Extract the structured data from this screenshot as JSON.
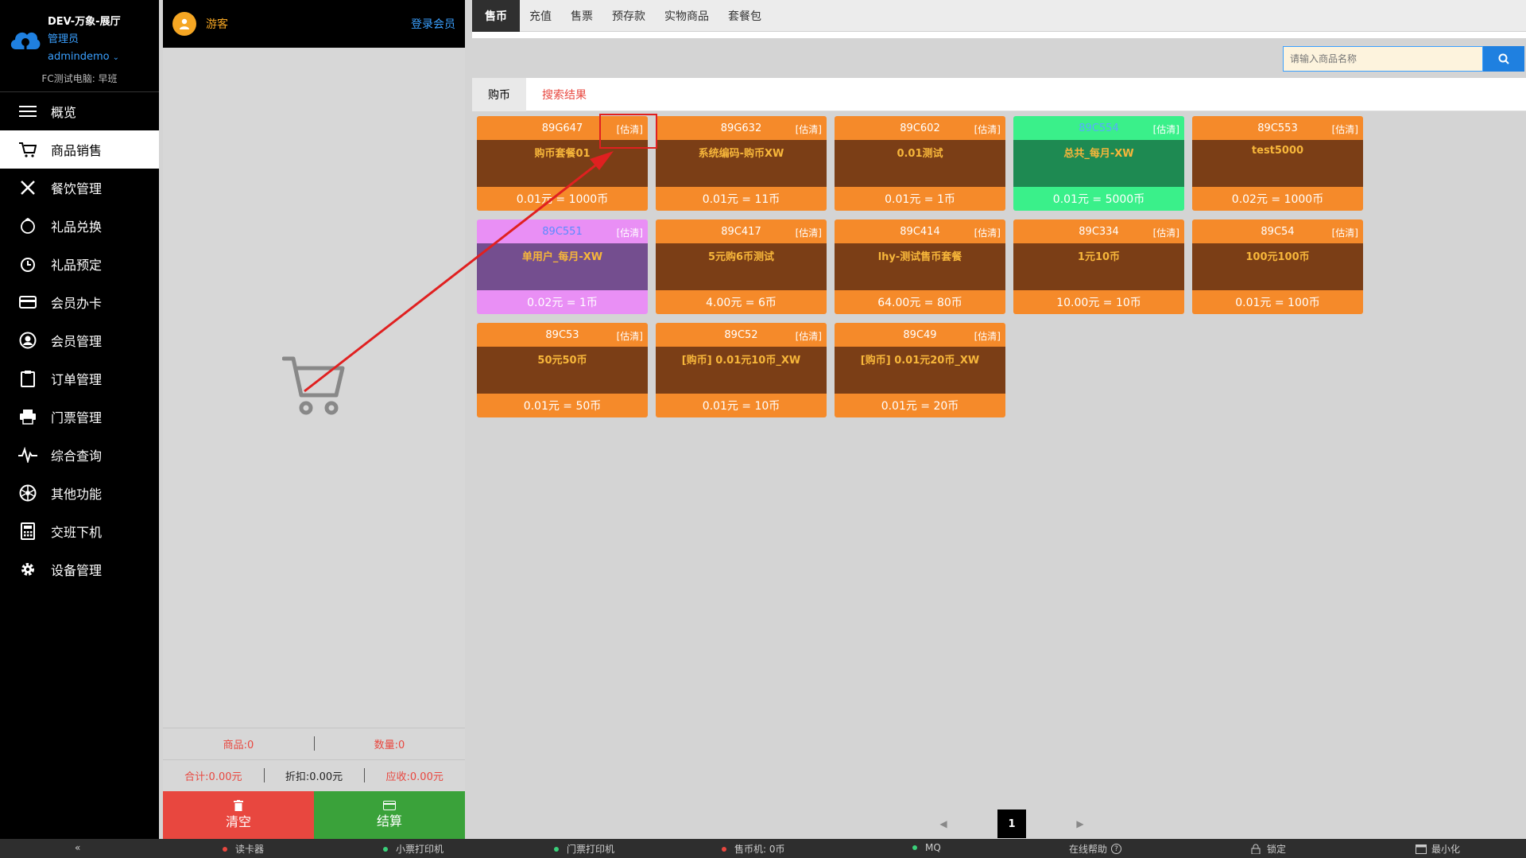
{
  "app": {
    "store_name": "DEV-万象-展厅",
    "role": "管理员",
    "username": "admindemo",
    "pc_info": "FC测试电脑: 早班"
  },
  "sidebar": {
    "items": [
      {
        "label": "概览",
        "icon": "menu-icon"
      },
      {
        "label": "商品销售",
        "icon": "cart-icon",
        "active": true
      },
      {
        "label": "餐饮管理",
        "icon": "utensils-icon"
      },
      {
        "label": "礼品兑换",
        "icon": "gift-icon"
      },
      {
        "label": "礼品预定",
        "icon": "alarm-icon"
      },
      {
        "label": "会员办卡",
        "icon": "card-icon"
      },
      {
        "label": "会员管理",
        "icon": "user-icon"
      },
      {
        "label": "订单管理",
        "icon": "clipboard-icon"
      },
      {
        "label": "门票管理",
        "icon": "printer-icon"
      },
      {
        "label": "综合查询",
        "icon": "pulse-icon"
      },
      {
        "label": "其他功能",
        "icon": "aperture-icon"
      },
      {
        "label": "交班下机",
        "icon": "calculator-icon"
      },
      {
        "label": "设备管理",
        "icon": "gear-icon"
      }
    ]
  },
  "cart": {
    "guest_label": "游客",
    "login_label": "登录会员",
    "items_label": "商品:0",
    "qty_label": "数量:0",
    "total_label": "合计:0.00元",
    "discount_label": "折扣:0.00元",
    "receivable_label": "应收:0.00元",
    "clear_label": "清空",
    "checkout_label": "结算"
  },
  "main": {
    "tabs": [
      "售币",
      "充值",
      "售票",
      "预存款",
      "实物商品",
      "套餐包"
    ],
    "search_placeholder": "请输入商品名称",
    "subtabs": [
      "购币",
      "搜索结果"
    ],
    "products": [
      {
        "code": "89G647",
        "tag": "[估清]",
        "name": "购币套餐01",
        "price": "0.01元 = 1000币",
        "theme": "orange"
      },
      {
        "code": "89G632",
        "tag": "[估清]",
        "name": "系统编码-购币XW",
        "price": "0.01元 = 11币",
        "theme": "orange"
      },
      {
        "code": "89C602",
        "tag": "[估清]",
        "name": "0.01测试",
        "price": "0.01元 = 1币",
        "theme": "orange"
      },
      {
        "code": "89C554",
        "tag": "[估清]",
        "name": "总共_每月-XW",
        "price": "0.01元 = 5000币",
        "theme": "green"
      },
      {
        "code": "89C553",
        "tag": "[估清]",
        "name": "test5000",
        "price": "0.02元 = 1000币",
        "theme": "orange"
      },
      {
        "code": "89C551",
        "tag": "[估清]",
        "name": "单用户_每月-XW",
        "price": "0.02元 = 1币",
        "theme": "purple"
      },
      {
        "code": "89C417",
        "tag": "[估清]",
        "name": "5元购6币测试",
        "price": "4.00元 = 6币",
        "theme": "orange"
      },
      {
        "code": "89C414",
        "tag": "[估清]",
        "name": "lhy-测试售币套餐",
        "price": "64.00元 = 80币",
        "theme": "orange"
      },
      {
        "code": "89C334",
        "tag": "[估清]",
        "name": "1元10币",
        "price": "10.00元 = 10币",
        "theme": "orange"
      },
      {
        "code": "89C54",
        "tag": "[估清]",
        "name": "100元100币",
        "price": "0.01元 = 100币",
        "theme": "orange"
      },
      {
        "code": "89C53",
        "tag": "[估清]",
        "name": "50元50币",
        "price": "0.01元 = 50币",
        "theme": "orange"
      },
      {
        "code": "89C52",
        "tag": "[估清]",
        "name": "[购币] 0.01元10币_XW",
        "price": "0.01元 = 10币",
        "theme": "orange"
      },
      {
        "code": "89C49",
        "tag": "[估清]",
        "name": "[购币] 0.01元20币_XW",
        "price": "0.01元 = 20币",
        "theme": "orange"
      }
    ],
    "page": "1"
  },
  "statusbar": {
    "collapse": "«",
    "card_reader": "读卡器",
    "receipt_printer": "小票打印机",
    "ticket_printer": "门票打印机",
    "coin_machine": "售币机: 0币",
    "mq": "MQ",
    "help": "在线帮助",
    "lock": "锁定",
    "minimize": "最小化"
  },
  "colors": {
    "accent": "#f58a2a",
    "danger": "#e8473f",
    "success": "#3aa23a",
    "link": "#3aa0ff"
  }
}
